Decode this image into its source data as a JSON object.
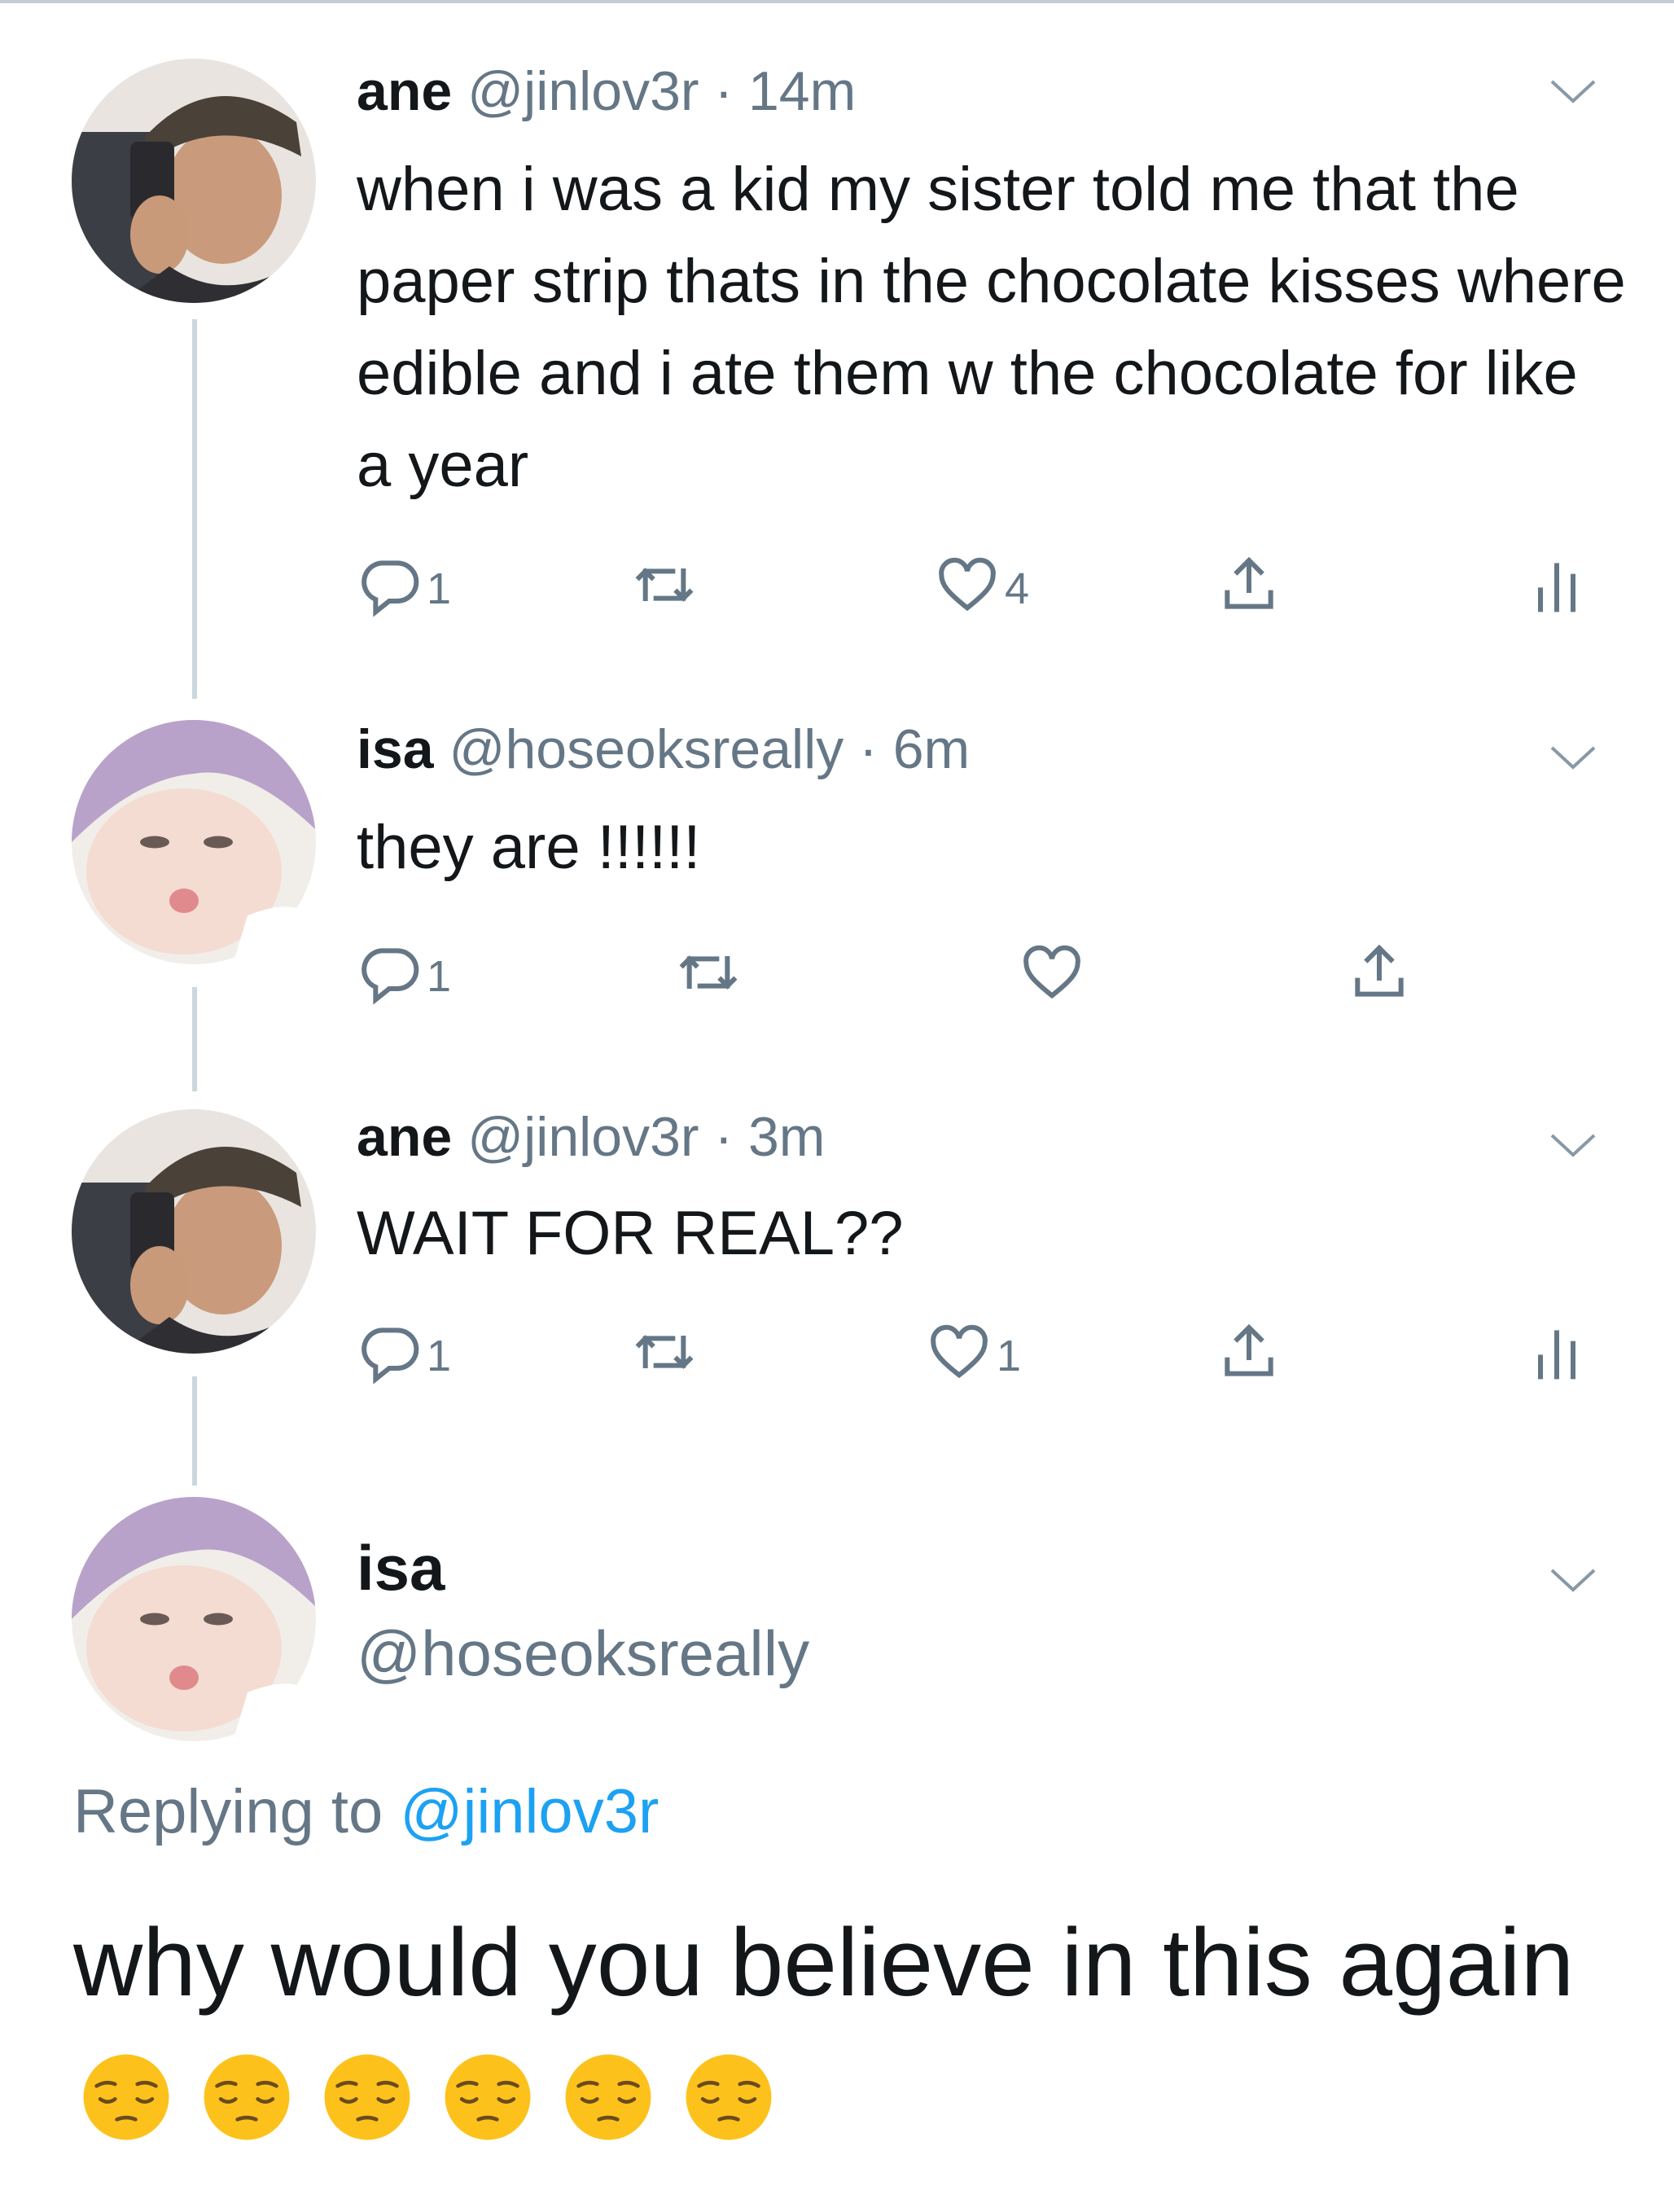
{
  "tweets": [
    {
      "name": "ane",
      "handle": "@jinlov3r",
      "separator": " · ",
      "time": "14m",
      "text": "when i was a kid my sister told me that the paper strip thats in the chocolate kisses where edible and i ate them w the chocolate for like a year",
      "reply_count": "1",
      "like_count": "4"
    },
    {
      "name": "isa",
      "handle": "@hoseoksreally",
      "separator": " · ",
      "time": "6m",
      "text": "they are !!!!!!",
      "reply_count": "1"
    },
    {
      "name": "ane",
      "handle": "@jinlov3r",
      "separator": " · ",
      "time": "3m",
      "text": "WAIT FOR REAL??",
      "reply_count": "1",
      "like_count": "1"
    }
  ],
  "focus_tweet": {
    "name": "isa",
    "handle": "@hoseoksreally",
    "replying_label": "Replying to",
    "replying_to": "@jinlov3r",
    "text": "why would you believe in this again",
    "emoji": [
      "😔",
      "😔",
      "😔",
      "😔",
      "😔",
      "😔"
    ]
  },
  "colors": {
    "text": "#14171a",
    "secondary": "#657786",
    "link": "#1da1f2",
    "thread_line": "#ccd6dd"
  },
  "icons": [
    "reply-icon",
    "retweet-icon",
    "like-icon",
    "share-icon",
    "analytics-icon",
    "caret-down-icon",
    "pensive-face-emoji"
  ]
}
